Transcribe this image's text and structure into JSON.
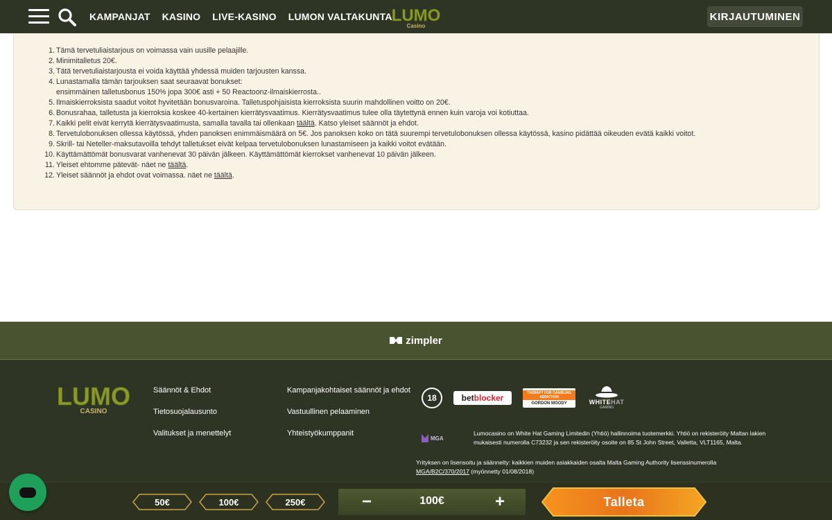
{
  "header": {
    "nav": [
      "KAMPANJAT",
      "KASINO",
      "LIVE-KASINO",
      "LUMON VALTAKUNTA"
    ],
    "logo_main": "LUMO",
    "logo_sub": "Casino",
    "login_label": "KIRJAUTUMINEN"
  },
  "terms": [
    {
      "n": "1.",
      "text": "Tämä tervetuliaistarjous on voimassa vain uusille pelaajille."
    },
    {
      "n": "2.",
      "text": "Minimitalletus 20€."
    },
    {
      "n": "3.",
      "text": "Tätä tervetuliaistarjousta ei voida käyttää yhdessä muiden tarjousten kanssa."
    },
    {
      "n": "4.",
      "text": "Lunastamalla tämän tarjouksen saat seuraavat bonukset:",
      "sub": "ensimmäinen talletusbonus 150% jopa 300€ asti + 50 Reactoonz-ilmaiskierrosta.."
    },
    {
      "n": "5.",
      "text": "Ilmaiskierroksista saadut voitot hyvitetään bonusvaroina. Talletuspohjaisista kierroksista suurin mahdollinen voitto on 20€."
    },
    {
      "n": "6.",
      "text": "Bonusrahaa, talletusta ja kierroksia koskee 40-kertainen kierrätysvaatimus. Kierrätysvaatimus tulee olla täytettynä ennen kuin varoja voi kotiuttaa."
    },
    {
      "n": "7.",
      "pre": "Kaikki pelit eivät kerrytä kierrätysvaatimusta, samalla tavalla tai ollenkaan ",
      "link": "täältä",
      "post": ". Katso yleiset säännöt ja ehdot."
    },
    {
      "n": "8.",
      "text": "Tervetulobonuksen ollessa käytössä, yhden panoksen enimmäismäärä on 5€. Jos panoksen koko on tätä suurempi tervetulobonuksen ollessa käytössä, kasino pidättää oikeuden evätä kaikki voitot."
    },
    {
      "n": "9.",
      "text": "Skrill- tai Neteller-maksutavoilla tehdyt talletukset eivät kelpaa tervetulobonuksen lunastamiseen ja kaikki voitot evätään."
    },
    {
      "n": "10.",
      "text": "Käyttämättömät bonusvarat vanhenevat 30 päivän jälkeen. Käyttämättömät kierrokset vanhenevat 10 päivän jälkeen."
    },
    {
      "n": "11.",
      "pre": "Yleiset ehtomme pätevät- näet ne ",
      "link": "täältä",
      "post": "."
    },
    {
      "n": "12.",
      "pre": "Yleiset säännöt ja ehdot ovat voimassa. näet ne ",
      "link": "täältä",
      "post": "."
    }
  ],
  "zimpler": "zimpler",
  "footer": {
    "logo_main": "LUMO",
    "logo_sub": "CASINO",
    "links_col1": [
      "Säännöt & Ehdot",
      "Tietosuojalausunto",
      "Valitukset ja menettelyt"
    ],
    "links_col2": [
      "Kampanjakohtaiset säännöt ja ehdot",
      "Vastuullinen pelaaminen",
      "Yhteistyökumppanit"
    ],
    "badge_18": "18",
    "betblocker_a": "bet",
    "betblocker_b": "blocker",
    "gordon_top": "THERAPY FOR GAMBLING ADDICTION",
    "gordon_bottom": "GORDON MOODY",
    "whitehat_a": "WHITE",
    "whitehat_b": "HAT",
    "whitehat_sub": "GAMING",
    "mga": "MGA",
    "legal_1a": "Lumocasino on White Hat Gaming Limitedin (Yhtiö) hallinnoima tuotemerkki. Yhtiö on rekisteröity Maltan lakien",
    "legal_1b": "mukaisesti numerolla C73232 ja sen rekisteröity osoite on 85 St John Street, Valletta, VLT1165, Malta.",
    "legal_2a": "Yrityksen on lisensoitu ja säännelty: kaikkien muiden asiakkaiden osalta Malta Gaming Authority lisenssinumerolla",
    "legal_2_link": "MGA/B2C/370/2017",
    "legal_2_post": " (myönnetty 01/08/2018)"
  },
  "bottom_bar": {
    "chips": [
      "50€",
      "100€",
      "250€"
    ],
    "amount": "100€",
    "minus": "−",
    "plus": "+",
    "deposit_label": "Talleta"
  },
  "colors": {
    "header_bg": "#2f3524",
    "terms_bg": "#f9f3e5",
    "zimpler_band": "#4a5330",
    "logo_green": "#8a9a2a",
    "deposit_gradient_start": "#f7931e",
    "chat_green": "#1fa05a"
  }
}
